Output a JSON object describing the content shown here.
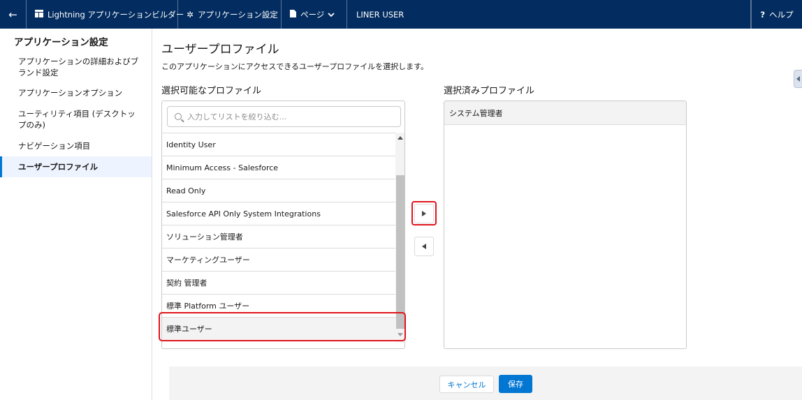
{
  "topbar": {
    "builder_label": "Lightning アプリケーションビルダー",
    "settings_label": "アプリケーション設定",
    "pages_label": "ページ",
    "app_name": "LINER USER",
    "help_label": "ヘルプ"
  },
  "sidebar": {
    "title": "アプリケーション設定",
    "items": [
      {
        "label": "アプリケーションの詳細およびブランド設定"
      },
      {
        "label": "アプリケーションオプション"
      },
      {
        "label": "ユーティリティ項目 (デスクトップのみ)"
      },
      {
        "label": "ナビゲーション項目"
      },
      {
        "label": "ユーザープロファイル"
      }
    ]
  },
  "main": {
    "title": "ユーザープロファイル",
    "description": "このアプリケーションにアクセスできるユーザープロファイルを選択します。",
    "available_label": "選択可能なプロファイル",
    "selected_label": "選択済みプロファイル",
    "search_placeholder": "入力してリストを絞り込む...",
    "available_profiles": [
      "Identity User",
      "Minimum Access - Salesforce",
      "Read Only",
      "Salesforce API Only System Integrations",
      "ソリューション管理者",
      "マーケティングユーザー",
      "契約 管理者",
      "標準 Platform ユーザー",
      "標準ユーザー"
    ],
    "selected_profiles": [
      "システム管理者"
    ]
  },
  "footer": {
    "cancel_label": "キャンセル",
    "save_label": "保存"
  },
  "colors": {
    "topbar_bg": "#032d60",
    "accent": "#0176d3",
    "highlight": "#e0141c"
  }
}
